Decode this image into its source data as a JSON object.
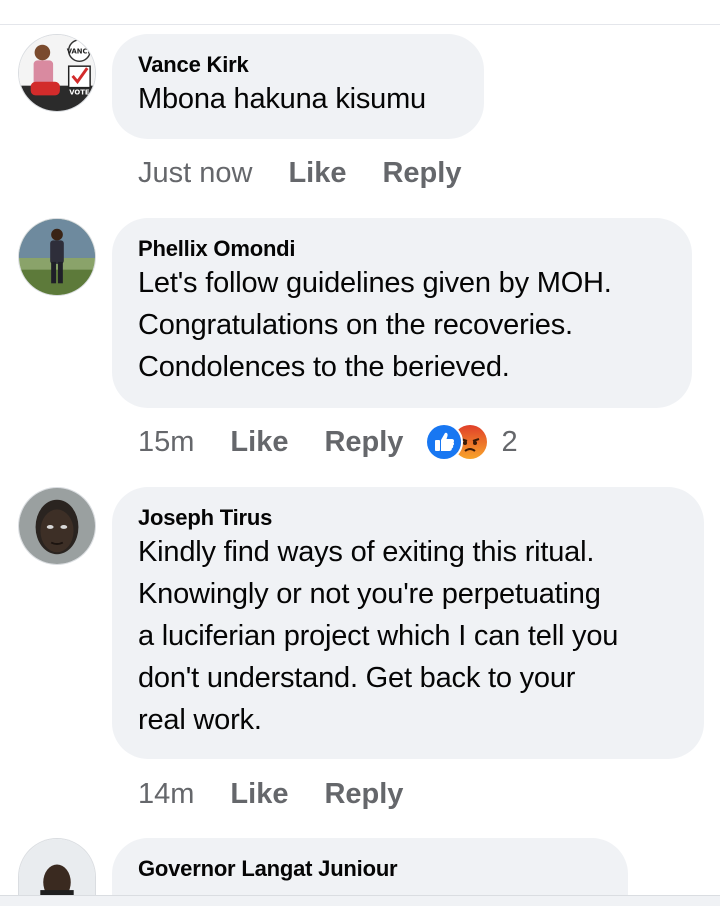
{
  "comments": [
    {
      "author": "Vance Kirk",
      "lines": [
        "Mbona hakuna kisumu"
      ],
      "time": "Just now",
      "like_label": "Like",
      "reply_label": "Reply",
      "avatar": {
        "kind": "campaign-poster",
        "words": [
          "VANCE",
          "VOTE"
        ]
      }
    },
    {
      "author": "Phellix Omondi",
      "lines": [
        "Let's follow guidelines given by MOH.",
        "Congratulations on the recoveries.",
        "Condolences to the berieved."
      ],
      "time": "15m",
      "like_label": "Like",
      "reply_label": "Reply",
      "reactions": {
        "icons": [
          "like-reaction-icon",
          "angry-reaction-icon"
        ],
        "count": "2"
      }
    },
    {
      "author": "Joseph Tirus",
      "lines": [
        "Kindly find ways of exiting this ritual.",
        "Knowingly or not you're perpetuating",
        "a luciferian project which I can tell you",
        "don't understand. Get back to your",
        "real work."
      ],
      "time": "14m",
      "like_label": "Like",
      "reply_label": "Reply"
    },
    {
      "author": "Governor Langat Juniour",
      "lines": []
    }
  ],
  "colors": {
    "bubble": "#f0f2f5",
    "meta": "#65676b",
    "like_blue": "#1877f2",
    "angry": "#f0862f"
  }
}
